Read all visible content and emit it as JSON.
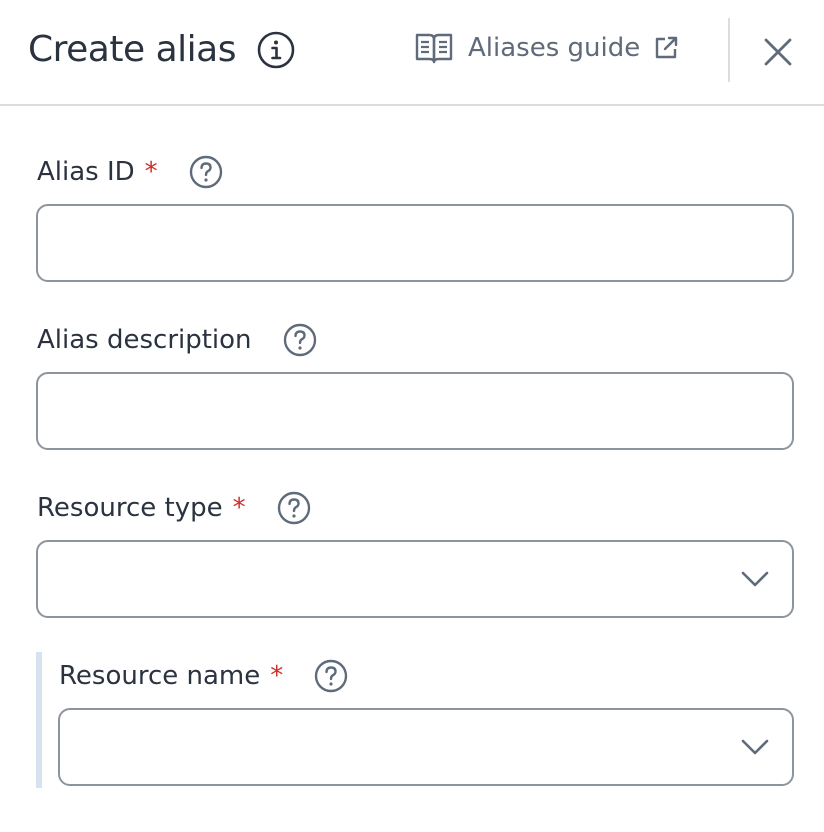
{
  "header": {
    "title": "Create alias",
    "guide_label": "Aliases guide",
    "icons": {
      "info": "info-circle-icon",
      "guide": "book-open-icon",
      "external": "external-link-icon",
      "close": "close-icon"
    }
  },
  "form": {
    "alias_id": {
      "label": "Alias ID",
      "required": "*",
      "value": "",
      "help_icon": "help-circle-icon"
    },
    "alias_description": {
      "label": "Alias description",
      "value": "",
      "help_icon": "help-circle-icon"
    },
    "resource_type": {
      "label": "Resource type",
      "required": "*",
      "selected": "",
      "help_icon": "help-circle-icon"
    },
    "resource_name": {
      "label": "Resource name",
      "required": "*",
      "selected": "",
      "help_icon": "help-circle-icon"
    }
  },
  "colors": {
    "text": "#2b3340",
    "muted": "#5f6b7a",
    "required": "#d12b2b",
    "border": "#8c949e",
    "divider": "#d9dde2",
    "nested_bar": "#d6e2ee"
  }
}
